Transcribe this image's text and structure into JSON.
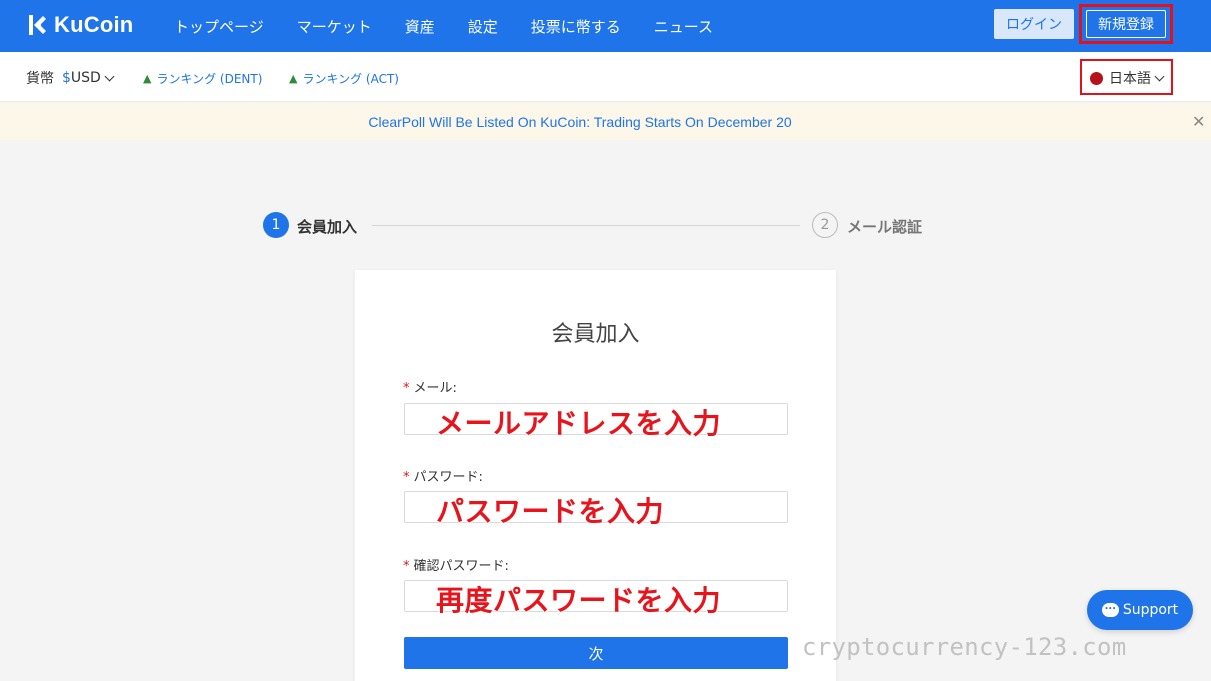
{
  "header": {
    "logo_text": "KuCoin",
    "nav": [
      "トップページ",
      "マーケット",
      "資産",
      "設定",
      "投票に幣する",
      "ニュース"
    ],
    "login_label": "ログイン",
    "signup_label": "新規登録"
  },
  "subbar": {
    "currency_label": "貨幣",
    "currency_symbol": "$",
    "currency_value": "USD",
    "rank1": "ランキング (DENT)",
    "rank2": "ランキング (ACT)",
    "language": "日本語"
  },
  "notice": {
    "text": "ClearPoll Will Be Listed On KuCoin: Trading Starts On December 20",
    "close": "✕"
  },
  "steps": [
    {
      "number": "1",
      "label": "会員加入"
    },
    {
      "number": "2",
      "label": "メール認証"
    }
  ],
  "form": {
    "title": "会員加入",
    "fields": [
      {
        "label": "メール:",
        "annotation": "メールアドレスを入力"
      },
      {
        "label": "パスワード:",
        "annotation": "パスワードを入力"
      },
      {
        "label": "確認パスワード:",
        "annotation": "再度パスワードを入力"
      }
    ],
    "required_mark": "*",
    "next_label": "次"
  },
  "watermark": "cryptocurrency-123.com",
  "support_label": "Support",
  "colors": {
    "brand": "#1e74e8",
    "highlight_red": "#e0121b"
  }
}
